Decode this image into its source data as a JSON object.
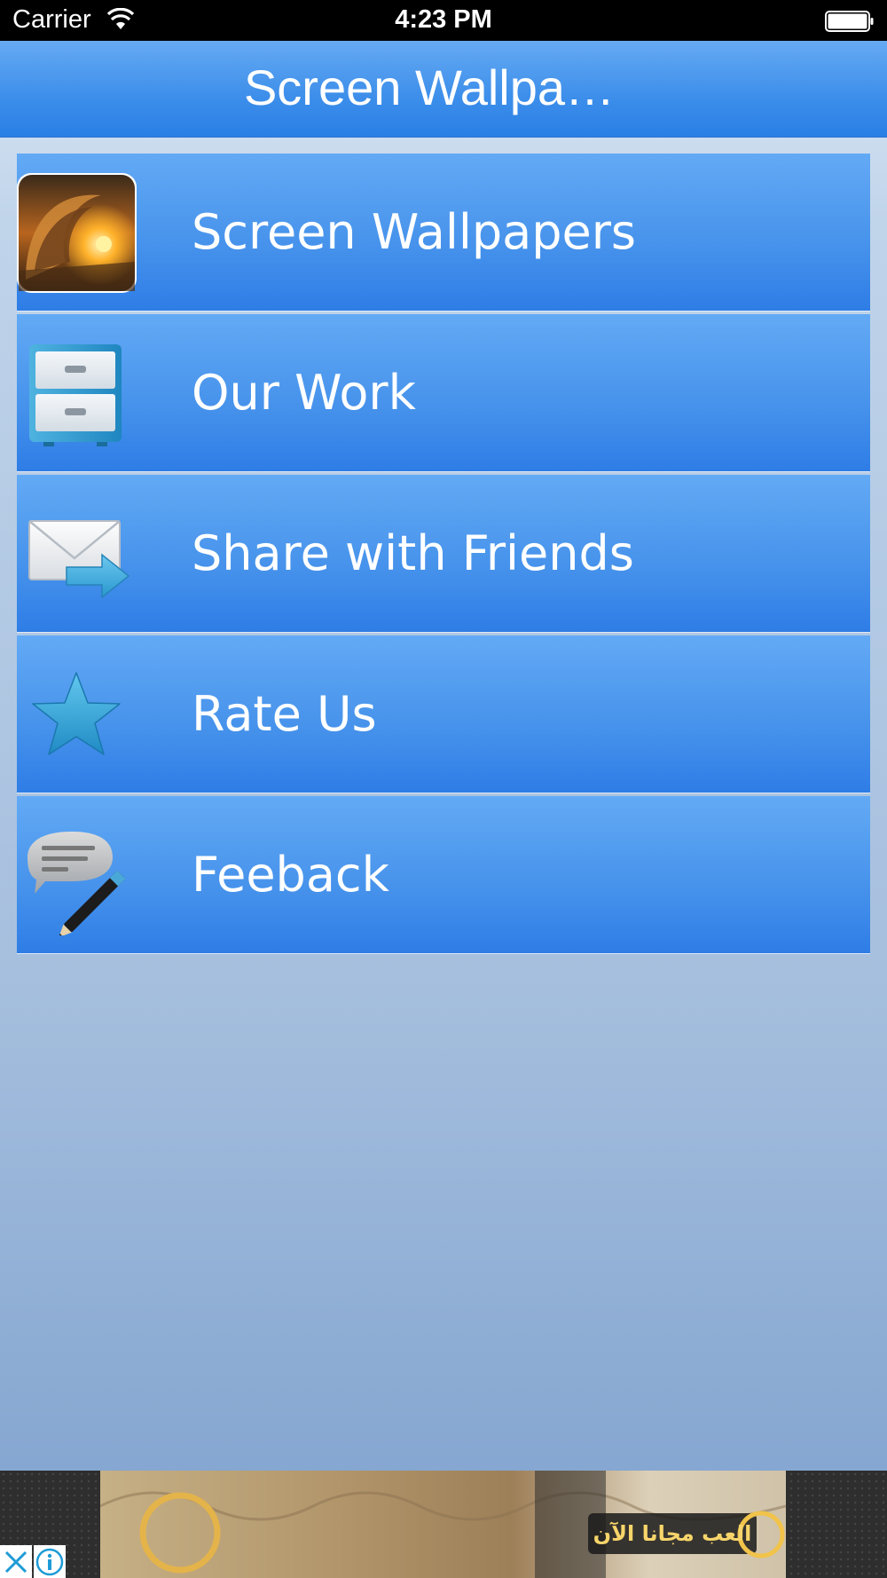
{
  "status_bar": {
    "carrier": "Carrier",
    "time": "4:23 PM"
  },
  "nav": {
    "title": "Screen Wallpa…"
  },
  "menu": {
    "items": [
      {
        "label": "Screen Wallpapers",
        "icon": "wave-app-icon"
      },
      {
        "label": "Our Work",
        "icon": "cabinet-icon"
      },
      {
        "label": "Share with Friends",
        "icon": "mail-forward-icon"
      },
      {
        "label": "Rate Us",
        "icon": "star-icon"
      },
      {
        "label": "Feeback",
        "icon": "feedback-icon"
      }
    ]
  },
  "ad": {
    "banner_text": "العب مجانا الآن"
  },
  "colors": {
    "nav_top": "#66aaf3",
    "nav_bottom": "#2a7fe6",
    "row_top": "#63aaf5",
    "row_bottom": "#2e7de6"
  }
}
